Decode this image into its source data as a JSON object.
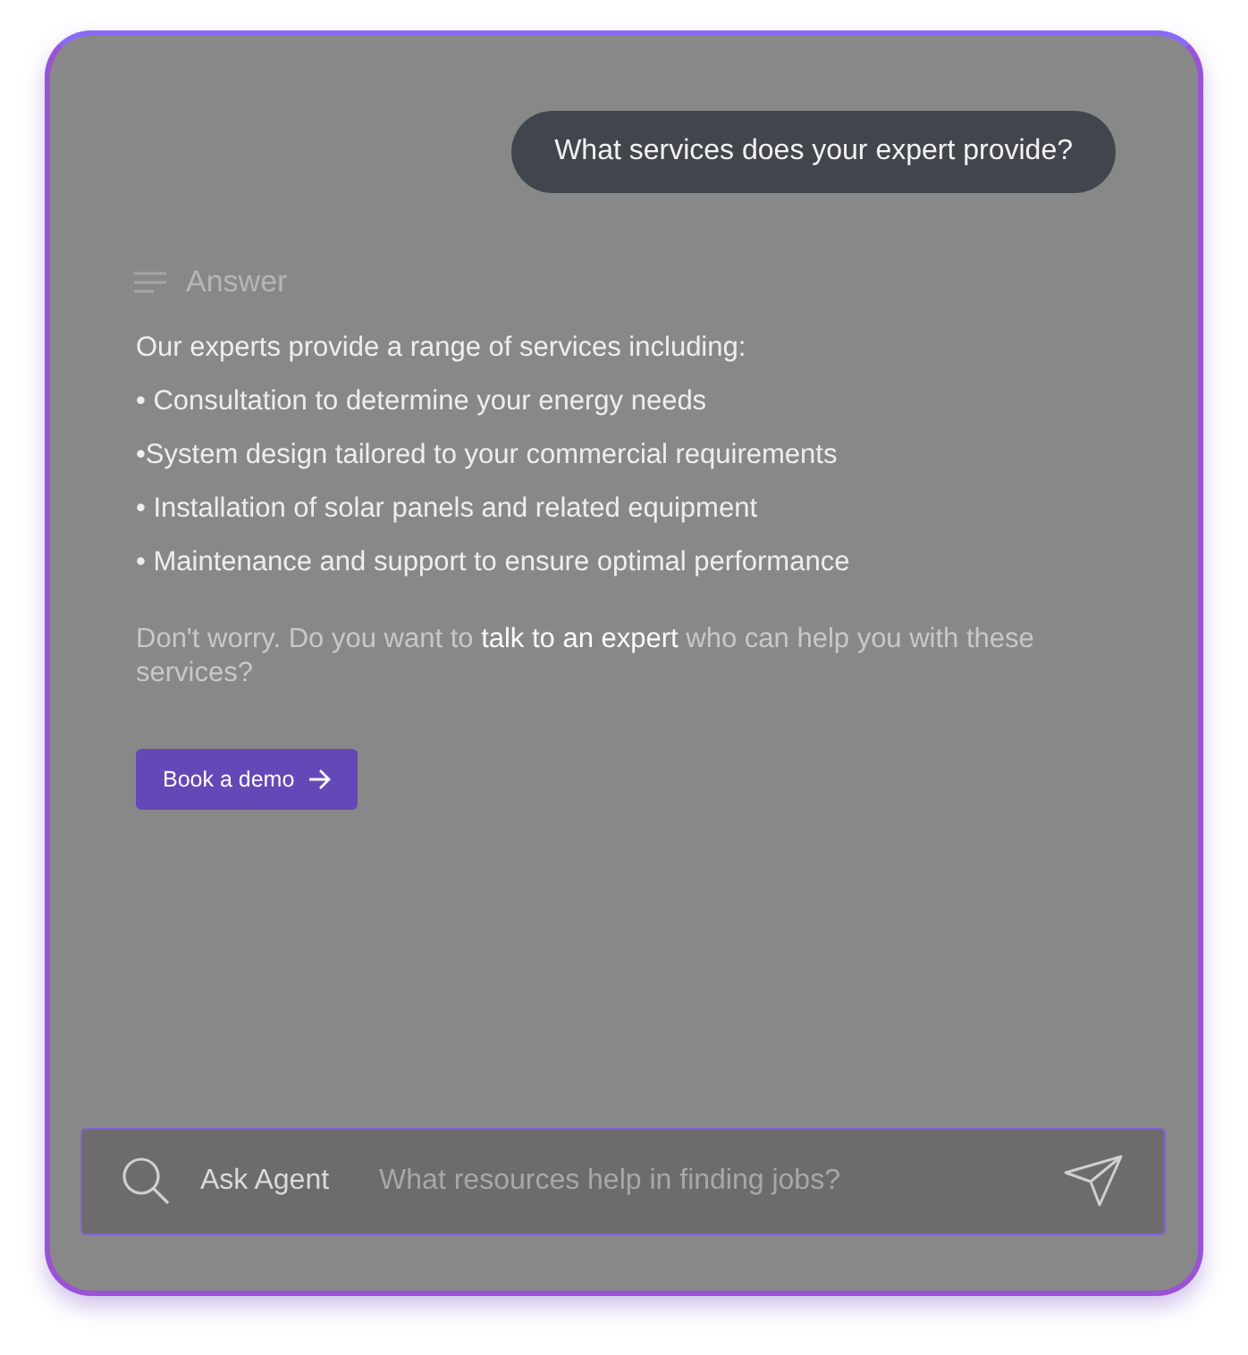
{
  "question": "What services does your expert provide?",
  "answer": {
    "heading": "Answer",
    "intro": "Our experts provide a range of services including:",
    "items": [
      "• Consultation to determine your energy needs",
      "•System design tailored to your commercial requirements",
      "• Installation of solar panels and related equipment",
      "• Maintenance and support to ensure optimal performance"
    ],
    "note": "Don't worry. Do you want to **talk to an expert** who can help you with these services?",
    "button": "Book a demo"
  },
  "ask_bar": {
    "label": "Ask Agent",
    "placeholder": "What resources help in finding jobs?"
  }
}
